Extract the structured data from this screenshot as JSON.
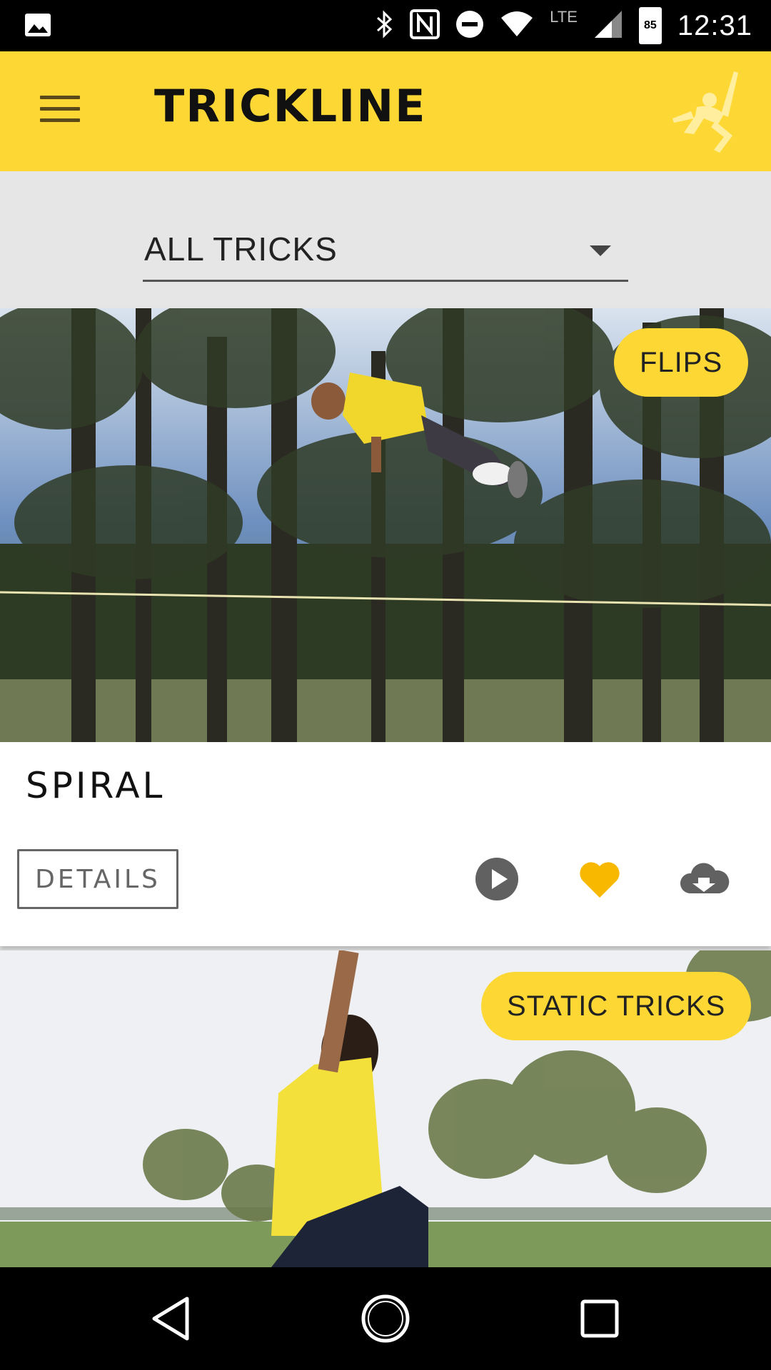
{
  "status_bar": {
    "time": "12:31",
    "network": "LTE",
    "battery": "85",
    "icons": [
      "image-icon",
      "bluetooth-icon",
      "nfc-icon",
      "do-not-disturb-icon",
      "wifi-icon",
      "signal-icon",
      "battery-icon"
    ]
  },
  "app_bar": {
    "title": "TRICKLINE",
    "background": "#fdd835"
  },
  "filter": {
    "selected": "ALL TRICKS"
  },
  "cards": [
    {
      "tag": "FLIPS",
      "title": "SPIRAL",
      "details_label": "DETAILS",
      "favorite_color": "#f9b800"
    },
    {
      "tag": "STATIC TRICKS"
    }
  ]
}
